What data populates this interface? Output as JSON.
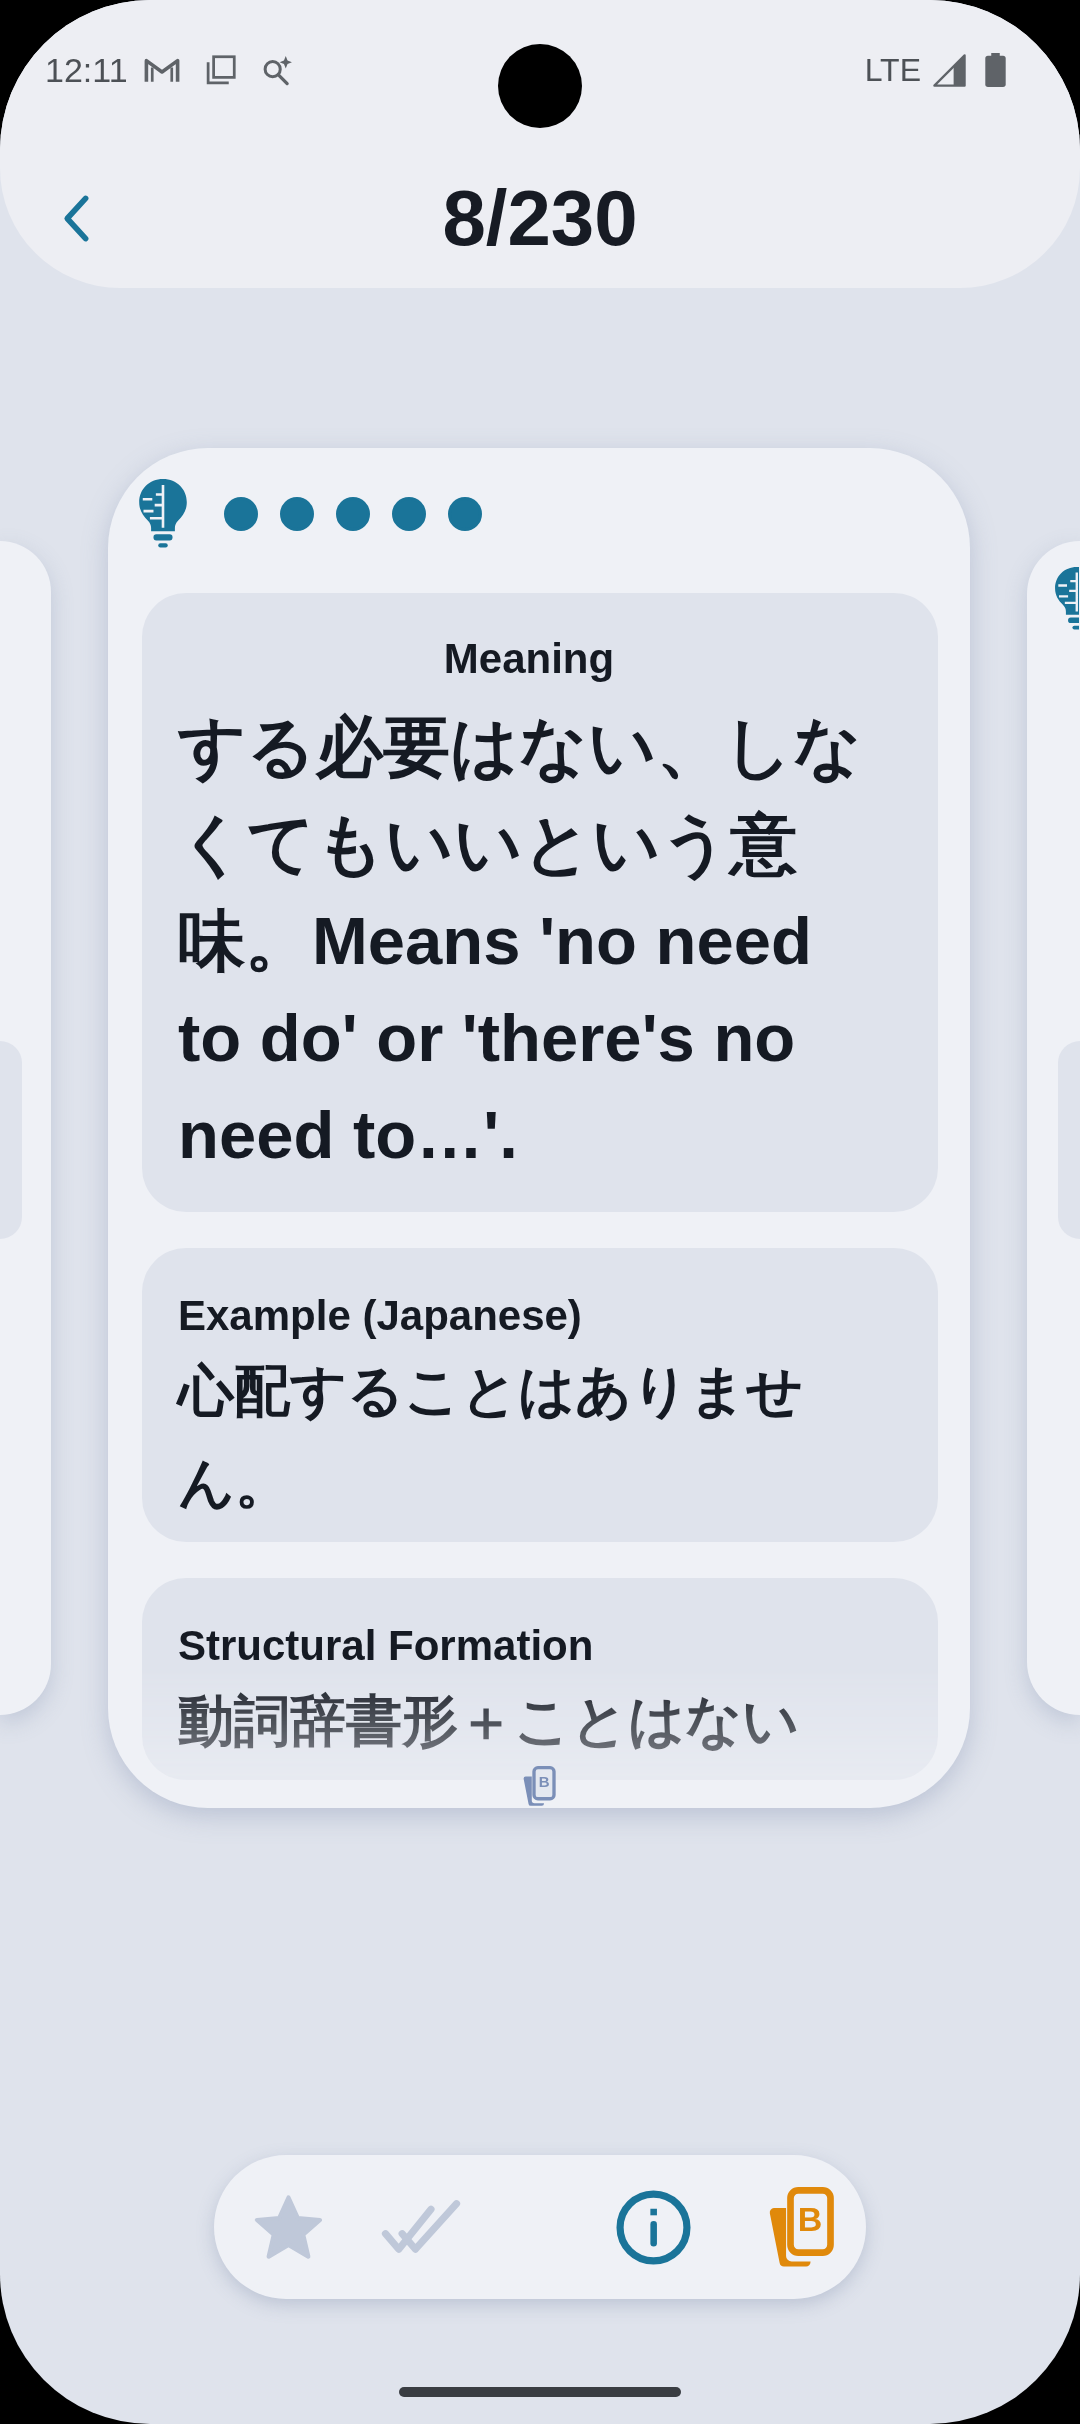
{
  "status_bar": {
    "time": "12:11",
    "network": "LTE"
  },
  "header": {
    "title": "8/230"
  },
  "card": {
    "dots": [
      {
        "filled": true
      },
      {
        "filled": true
      },
      {
        "filled": true
      },
      {
        "filled": true
      },
      {
        "filled": true
      }
    ],
    "sections": [
      {
        "kind": "primary",
        "label": "Meaning",
        "text": "する必要はない、しなくてもいいという意味。Means 'no need to do' or 'there's no need to…'."
      },
      {
        "kind": "secondary",
        "label": "Example (Japanese)",
        "text": "心配することはありません。"
      },
      {
        "kind": "secondary",
        "label": "Structural Formation",
        "text": "動詞辞書形＋ことはない"
      }
    ],
    "hint": {
      "letter": "B"
    }
  },
  "bottom_bar": {
    "actions": [
      {
        "kind": "star",
        "on": false
      },
      {
        "kind": "double-check",
        "on": false
      },
      {
        "kind": "info"
      },
      {
        "kind": "cards",
        "letter": "B"
      }
    ]
  }
}
